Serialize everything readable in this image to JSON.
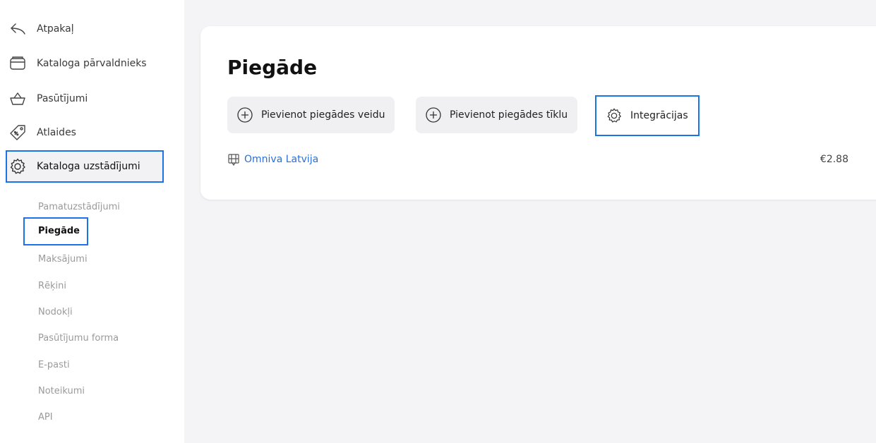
{
  "sidebar": {
    "back_label": "Atpakaļ",
    "items": [
      {
        "label": "Kataloga pārvaldnieks",
        "icon": "folder-icon"
      },
      {
        "label": "Pasūtījumi",
        "icon": "basket-icon"
      },
      {
        "label": "Atlaides",
        "icon": "discount-tag-icon"
      },
      {
        "label": "Kataloga uzstādījumi",
        "icon": "gear-icon"
      }
    ],
    "sub_items": [
      "Pamatuzstādījumi",
      "Piegāde",
      "Maksājumi",
      "Rēķini",
      "Nodokļi",
      "Pasūtījumu forma",
      "E-pasti",
      "Noteikumi",
      "API"
    ],
    "active_item": "Kataloga uzstādījumi",
    "active_sub_item": "Piegāde"
  },
  "main": {
    "title": "Piegāde",
    "actions": [
      {
        "label": "Pievienot piegādes veidu",
        "icon": "plus-circle-icon"
      },
      {
        "label": "Pievienot piegādes tīklu",
        "icon": "plus-circle-icon"
      },
      {
        "label": "Integrācijas",
        "icon": "gear-icon"
      }
    ],
    "delivery_methods": [
      {
        "name": "Omniva Latvija",
        "price": "€2.88",
        "icon": "parcel-locker-icon"
      }
    ]
  },
  "colors": {
    "accent": "#1a73e8",
    "link": "#2a6fd6",
    "background": "#f4f4f6"
  }
}
